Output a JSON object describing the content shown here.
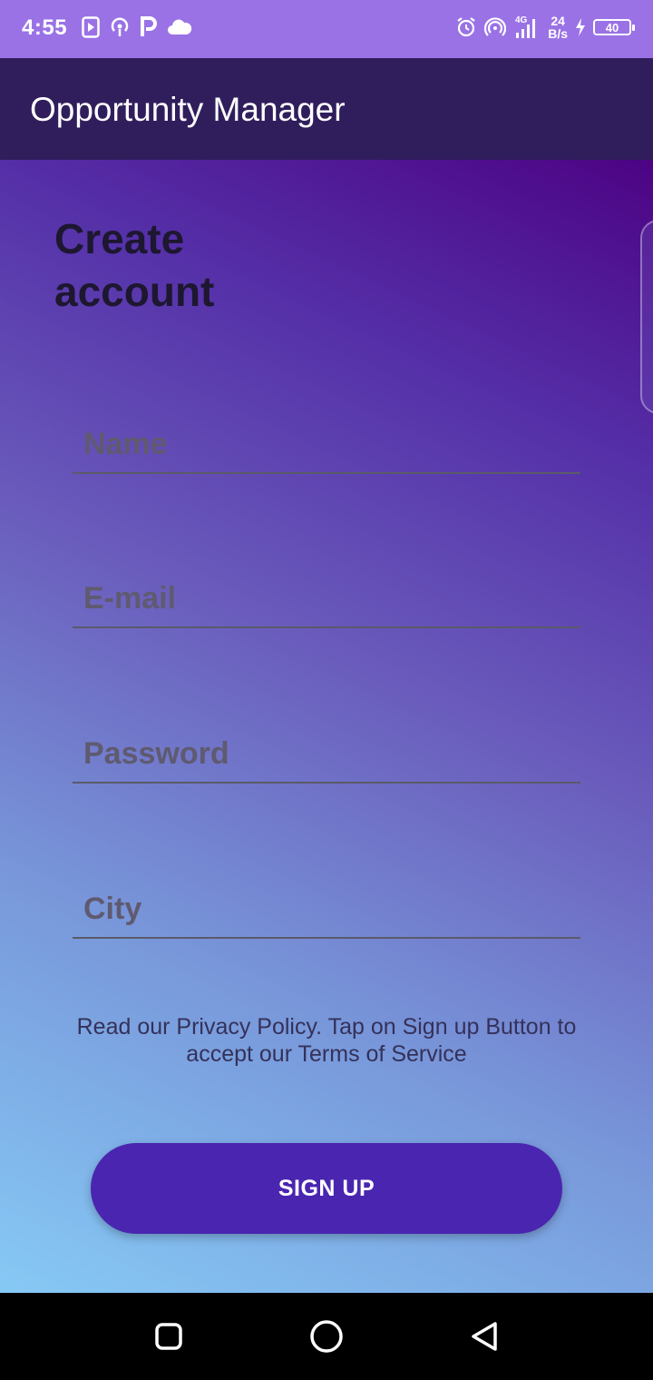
{
  "status_bar": {
    "time": "4:55",
    "left_icons": [
      "media-play-icon",
      "hotspot-icon",
      "parking-p-icon",
      "cloud-icon"
    ],
    "right_icons": [
      "alarm-icon",
      "wifi-hotspot-icon",
      "signal-4g-icon"
    ],
    "network_type": "4G",
    "net_speed_value": "24",
    "net_speed_unit": "B/s",
    "battery_level": "40",
    "charging": true
  },
  "app_bar": {
    "title": "Opportunity Manager"
  },
  "form": {
    "heading": "Create account",
    "fields": {
      "name_placeholder": "Name",
      "email_placeholder": "E-mail",
      "password_placeholder": "Password",
      "city_placeholder": "City"
    },
    "privacy_text": "Read our Privacy Policy. Tap on Sign up Button to accept our Terms of Service",
    "signup_label": "SIGN UP"
  },
  "colors": {
    "status_bar": "#9a72e6",
    "app_bar": "#301e5c",
    "button": "#4a25b0",
    "gradient_top": "#4c0384",
    "gradient_bottom": "#86c9f5"
  },
  "nav_bar": {
    "icons": [
      "recent-apps-icon",
      "home-icon",
      "back-icon"
    ]
  }
}
